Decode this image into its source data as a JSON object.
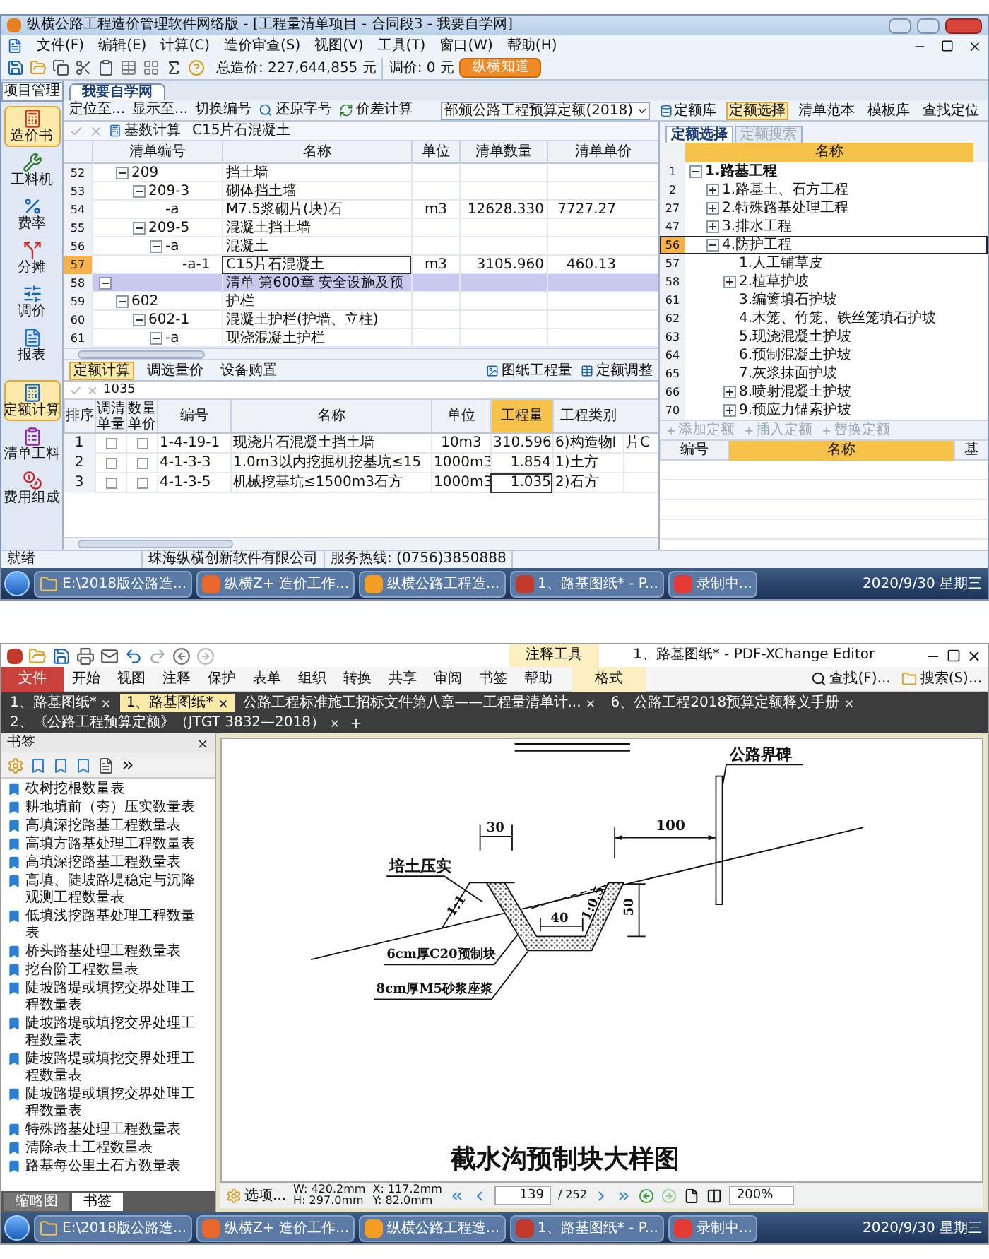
{
  "estimate_screen": {
    "title": "纵横公路工程造价管理软件网络版 - [工程量清单项目 - 合同段3 - 我要自学网]",
    "menu": [
      "文件(F)",
      "编辑(E)",
      "计算(C)",
      "造价审查(S)",
      "视图(V)",
      "工具(T)",
      "窗口(W)",
      "帮助(H)"
    ],
    "total_cost": "总造价: 227,644,855 元",
    "price_adjust": "调价: 0 元",
    "help_button": "纵横知道",
    "nav_tab": "项目管理",
    "nav_items": [
      {
        "label": "造价书",
        "kind": "book",
        "selected": true
      },
      {
        "label": "工料机",
        "kind": "tools",
        "selected": false
      },
      {
        "label": "费率",
        "kind": "rate",
        "selected": false
      },
      {
        "label": "分摊",
        "kind": "split",
        "selected": false
      },
      {
        "label": "调价",
        "kind": "adjust",
        "selected": false
      },
      {
        "label": "报表",
        "kind": "report",
        "selected": false
      }
    ],
    "nav_items_lower": [
      {
        "label": "定额计算",
        "kind": "calc",
        "selected": true
      },
      {
        "label": "清单工料",
        "kind": "list",
        "selected": false
      },
      {
        "label": "费用组成",
        "kind": "cost",
        "selected": false
      }
    ],
    "doc_tab": "我要自学网",
    "toolbar": [
      {
        "label": "定位至...",
        "kind": "plain"
      },
      {
        "label": "显示至...",
        "kind": "plain"
      },
      {
        "label": "切换编号",
        "kind": "plain"
      },
      {
        "label": "还原字号",
        "kind": "zoom"
      },
      {
        "label": "价差计算",
        "kind": "calc"
      }
    ],
    "quota_dropdown": "部颁公路工程预算定额(2018)",
    "library_buttons": [
      {
        "label": "定额库",
        "selected": false
      },
      {
        "label": "定额选择",
        "selected": true
      },
      {
        "label": "清单范本",
        "selected": false
      },
      {
        "label": "模板库",
        "selected": false
      },
      {
        "label": "查找定位",
        "selected": false
      }
    ],
    "edit_bar": {
      "button": "基数计算",
      "value": "C15片石混凝土"
    },
    "bill_grid": {
      "columns": [
        "清单编号",
        "名称",
        "单位",
        "清单数量",
        "清单单价"
      ],
      "rows": [
        {
          "row": "52",
          "kind": "item",
          "code": "209",
          "name": "挡土墙",
          "expanded": true,
          "selected": false,
          "children": [
            {
              "row": "53",
              "kind": "item",
              "code": "209-3",
              "name": "砌体挡土墙",
              "expanded": true,
              "selected": false,
              "children": [
                {
                  "row": "54",
                  "kind": "item",
                  "code": "-a",
                  "name": "M7.5浆砌片(块)石",
                  "unit": "m3",
                  "quantity": "12628.330",
                  "price": "7727.27",
                  "selected": false
                }
              ]
            },
            {
              "row": "55",
              "kind": "item",
              "code": "209-5",
              "name": "混凝土挡土墙",
              "expanded": true,
              "selected": false,
              "children": [
                {
                  "row": "56",
                  "kind": "item",
                  "code": "-a",
                  "name": "混凝土",
                  "expanded": true,
                  "selected": false,
                  "children": [
                    {
                      "row": "57",
                      "kind": "item",
                      "code": "-a-1",
                      "name": "C15片石混凝土",
                      "unit": "m3",
                      "quantity": "3105.960",
                      "price": "460.13",
                      "selected": true
                    }
                  ]
                }
              ]
            }
          ]
        },
        {
          "row": "58",
          "kind": "section",
          "name": "清单 第600章 安全设施及预",
          "expanded": true,
          "selected": false,
          "children": [
            {
              "row": "59",
              "kind": "item",
              "code": "602",
              "name": "护栏",
              "expanded": true,
              "selected": false,
              "children": [
                {
                  "row": "60",
                  "kind": "item",
                  "code": "602-1",
                  "name": "混凝土护栏(护墙、立柱)",
                  "expanded": true,
                  "selected": false,
                  "children": [
                    {
                      "row": "61",
                      "kind": "item",
                      "code": "-a",
                      "name": "现浇混凝土护栏",
                      "expanded": true,
                      "selected": false
                    }
                  ]
                }
              ]
            }
          ]
        }
      ]
    },
    "calc_tabs": [
      {
        "label": "定额计算",
        "selected": true
      },
      {
        "label": "调选量价",
        "selected": false
      },
      {
        "label": "设备购置",
        "selected": false
      }
    ],
    "calc_buttons": [
      "图纸工程量",
      "定额调整"
    ],
    "calc_input": "1035",
    "quota_grid": {
      "columns": [
        "排序",
        "调清单量",
        "数量单价",
        "编号",
        "名称",
        "单位",
        "工程量",
        "工程类别"
      ],
      "rows": [
        {
          "index": "1",
          "adjust_bill": false,
          "qty_price": false,
          "code": "1-4-19-1",
          "name": "现浇片石混凝土挡土墙",
          "unit": "10m3",
          "quantity": "310.596",
          "category": "6)构造物Ⅰ",
          "column_9": "片C",
          "selected": false
        },
        {
          "index": "2",
          "adjust_bill": false,
          "qty_price": false,
          "code": "4-1-3-3",
          "name": "1.0m3以内挖掘机挖基坑≤15",
          "unit": "1000m3",
          "quantity": "1.854",
          "category": "1)土方",
          "selected": false
        },
        {
          "index": "3",
          "adjust_bill": false,
          "qty_price": false,
          "code": "4-1-3-5",
          "name": "机械挖基坑≤1500m3石方",
          "unit": "1000m3",
          "quantity": "1.035",
          "category": "2)石方",
          "selected": true
        }
      ]
    },
    "library_panel": {
      "tabs": [
        {
          "label": "定额选择",
          "selected": true
        },
        {
          "label": "定额搜索",
          "selected": false
        }
      ],
      "column": "名称",
      "tree": [
        {
          "row": "1",
          "label": "1.路基工程",
          "expanded": true,
          "selected": false,
          "children": [
            {
              "row": "2",
              "label": "1.路基土、石方工程",
              "expanded": false,
              "selected": false
            },
            {
              "row": "27",
              "label": "2.特殊路基处理工程",
              "expanded": false,
              "selected": false
            },
            {
              "row": "47",
              "label": "3.排水工程",
              "expanded": false,
              "selected": false
            },
            {
              "row": "56",
              "label": "4.防护工程",
              "expanded": true,
              "selected": true,
              "children": [
                {
                  "row": "57",
                  "label": "1.人工铺草皮",
                  "selected": false
                },
                {
                  "row": "58",
                  "label": "2.植草护坡",
                  "expanded": false,
                  "selected": false
                },
                {
                  "row": "61",
                  "label": "3.编篱填石护坡",
                  "selected": false
                },
                {
                  "row": "62",
                  "label": "4.木笼、竹笼、铁丝笼填石护坡",
                  "selected": false
                },
                {
                  "row": "63",
                  "label": "5.现浇混凝土护坡",
                  "selected": false
                },
                {
                  "row": "64",
                  "label": "6.预制混凝土护坡",
                  "selected": false
                },
                {
                  "row": "65",
                  "label": "7.灰浆抹面护坡",
                  "selected": false
                },
                {
                  "row": "66",
                  "label": "8.喷射混凝土护坡",
                  "expanded": false,
                  "selected": false
                },
                {
                  "row": "70",
                  "label": "9.预应力锚索护坡",
                  "expanded": false,
                  "selected": false
                }
              ]
            }
          ]
        }
      ],
      "actions": [
        "添加定额",
        "插入定额",
        "替换定额"
      ],
      "detail_columns": [
        "编号",
        "名称",
        "基"
      ]
    },
    "status_bar": [
      "就绪",
      "珠海纵横创新软件有限公司",
      "服务热线: (0756)3850888"
    ],
    "taskbar": {
      "items": [
        {
          "label": "E:\\2018版公路造...",
          "kind": "folder"
        },
        {
          "label": "纵横Z+ 造价工作...",
          "kind": "z"
        },
        {
          "label": "纵横公路工程造...",
          "kind": "s"
        },
        {
          "label": "1、路基图纸* - P...",
          "kind": "pdf"
        },
        {
          "label": "录制中...",
          "kind": "rec"
        }
      ],
      "clock": "2020/9/30 星期三"
    }
  },
  "pdf_screen": {
    "title": "1、路基图纸* - PDF-XChange Editor",
    "context_tab": "注释工具",
    "ribbon_tabs": [
      {
        "label": "文件",
        "kind": "file"
      },
      {
        "label": "开始",
        "kind": "tab"
      },
      {
        "label": "视图",
        "kind": "tab"
      },
      {
        "label": "注释",
        "kind": "tab"
      },
      {
        "label": "保护",
        "kind": "tab"
      },
      {
        "label": "表单",
        "kind": "tab"
      },
      {
        "label": "组织",
        "kind": "tab"
      },
      {
        "label": "转换",
        "kind": "tab"
      },
      {
        "label": "共享",
        "kind": "tab"
      },
      {
        "label": "审阅",
        "kind": "tab"
      },
      {
        "label": "书签",
        "kind": "tab"
      },
      {
        "label": "帮助",
        "kind": "tab"
      },
      {
        "label": "格式",
        "kind": "context"
      }
    ],
    "find": "查找(F)...",
    "search": "搜索(S)...",
    "doc_tabs": [
      {
        "label": "1、路基图纸*",
        "selected": false
      },
      {
        "label": "1、路基图纸*",
        "selected": true
      },
      {
        "label": "公路工程标准施工招标文件第八章——工程量清单计...",
        "selected": false
      },
      {
        "label": "6、公路工程2018预算定额释义手册",
        "selected": false
      },
      {
        "label": "2、《公路工程预算定额》（JTGT 3832—2018）",
        "selected": false
      }
    ],
    "bookmarks_title": "书签",
    "bookmarks": [
      "砍树挖根数量表",
      "耕地填前（夯）压实数量表",
      "高填深挖路基工程数量表",
      "高填方路基处理工程数量表",
      "高填深挖路基工程数量表",
      "高填、陡坡路堤稳定与沉降观测工程数量表",
      "低填浅挖路基处理工程数量表",
      "桥头路基处理工程数量表",
      "挖台阶工程数量表",
      "陡坡路堤或填挖交界处理工程数量表",
      "陡坡路堤或填挖交界处理工程数量表",
      "陡坡路堤或填挖交界处理工程数量表",
      "陡坡路堤或填挖交界处理工程数量表",
      "特殊路基处理工程数量表",
      "清除表土工程数量表",
      "路基每公里土石方数量表"
    ],
    "panel_tabs": [
      {
        "label": "缩略图",
        "selected": false
      },
      {
        "label": "书签",
        "selected": true
      }
    ],
    "drawing": {
      "sign_label": "公路界碑",
      "dim_100": "100",
      "dim_30": "30",
      "fill_label": "培土压实",
      "slope_left": "1:1",
      "slope_right": "1:0.5",
      "dim_40": "40",
      "dim_50": "50",
      "block_label": "6cm厚C20预制块",
      "mortar_label": "8cm厚M5砂浆座浆",
      "title": "截水沟预制块大样图"
    },
    "status": {
      "options": "选项...",
      "width": "W: 420.2mm",
      "height": "H: 297.0mm",
      "x": "X: 117.2mm",
      "y": "Y: 82.0mm",
      "page": "139",
      "page_count": "/ 252",
      "zoom": "200%"
    },
    "taskbar": {
      "items": [
        {
          "label": "E:\\2018版公路造...",
          "kind": "folder"
        },
        {
          "label": "纵横Z+ 造价工作...",
          "kind": "z"
        },
        {
          "label": "纵横公路工程造...",
          "kind": "s"
        },
        {
          "label": "1、路基图纸* - P...",
          "kind": "pdf"
        },
        {
          "label": "录制中...",
          "kind": "rec"
        }
      ],
      "clock": "2020/9/30 星期三"
    }
  }
}
